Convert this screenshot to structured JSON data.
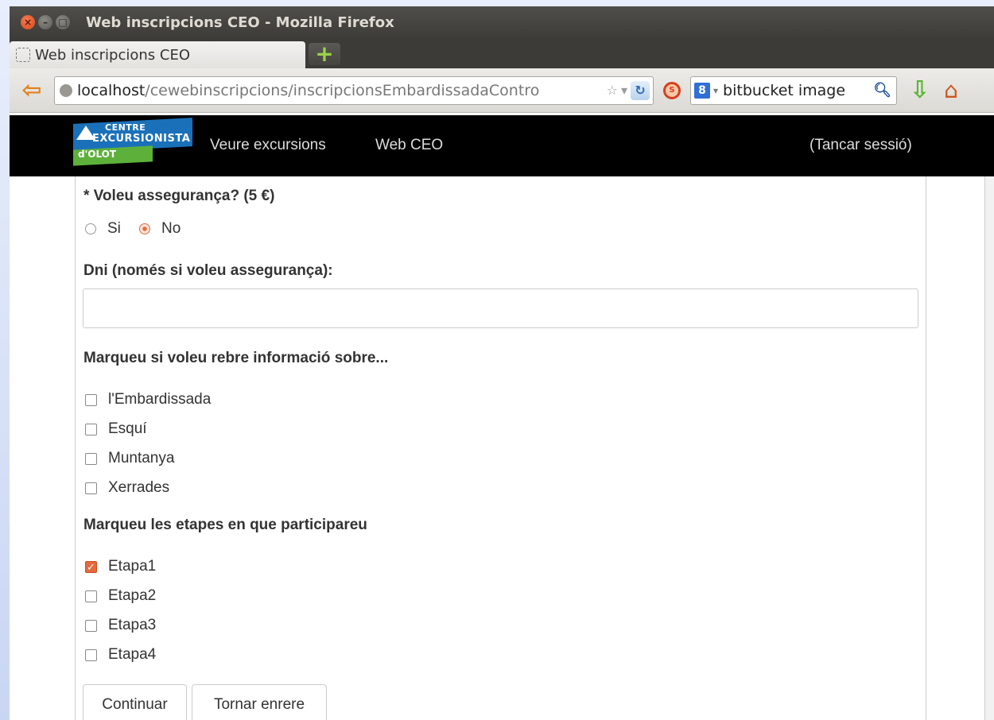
{
  "window": {
    "title": "Web inscripcions CEO - Mozilla Firefox",
    "tab_label": "Web inscripcions CEO"
  },
  "toolbar": {
    "url_host": "localhost",
    "url_path": "/cewebinscripcions/inscripcionsEmbardissadaContro",
    "search_value": "bitbucket image"
  },
  "site": {
    "logo_line1": "CENTRE",
    "logo_line2": "EXCURSIONISTA",
    "logo_line3": "d'OLOT",
    "nav": {
      "excursions": "Veure excursions",
      "web": "Web CEO",
      "logout": "(Tancar sessió)"
    }
  },
  "form": {
    "insurance_label": "* Voleu assegurança? (5 €)",
    "insurance_options": [
      "Si",
      "No"
    ],
    "insurance_selected": "No",
    "dni_label": "Dni (només si voleu assegurança):",
    "dni_value": "",
    "info_label": "Marqueu si voleu rebre informació sobre...",
    "info_options": [
      "l'Embardissada",
      "Esquí",
      "Muntanya",
      "Xerrades"
    ],
    "stages_label": "Marqueu les etapes en que participareu",
    "stages": [
      {
        "label": "Etapa1",
        "checked": true
      },
      {
        "label": "Etapa2",
        "checked": false
      },
      {
        "label": "Etapa3",
        "checked": false
      },
      {
        "label": "Etapa4",
        "checked": false
      }
    ],
    "continue_label": "Continuar",
    "back_label": "Tornar enrere"
  },
  "colors": {
    "accent": "#e66a3a",
    "navbar": "#000000",
    "logo_blue": "#1b71b9",
    "logo_green": "#5db13b"
  }
}
